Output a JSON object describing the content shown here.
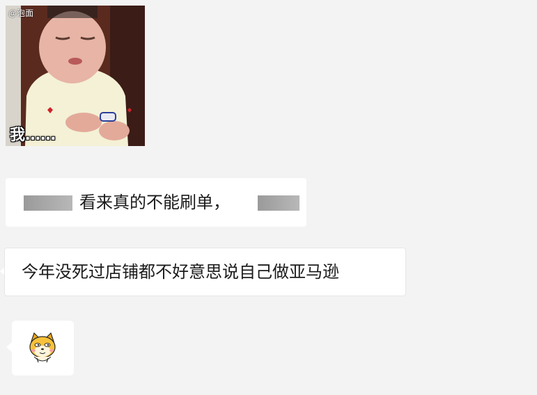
{
  "messages": [
    {
      "type": "image",
      "watermark": "@泡面",
      "caption": "我……"
    },
    {
      "type": "text",
      "text": "看来真的不能刷单，"
    },
    {
      "type": "text",
      "text": "今年没死过店铺都不好意思说自己做亚马逊"
    },
    {
      "type": "sticker",
      "icon": "doge-cat-sticker-icon"
    }
  ],
  "colors": {
    "background": "#f3f3f3",
    "bubble": "#ffffff",
    "text": "#1b1b1b"
  }
}
